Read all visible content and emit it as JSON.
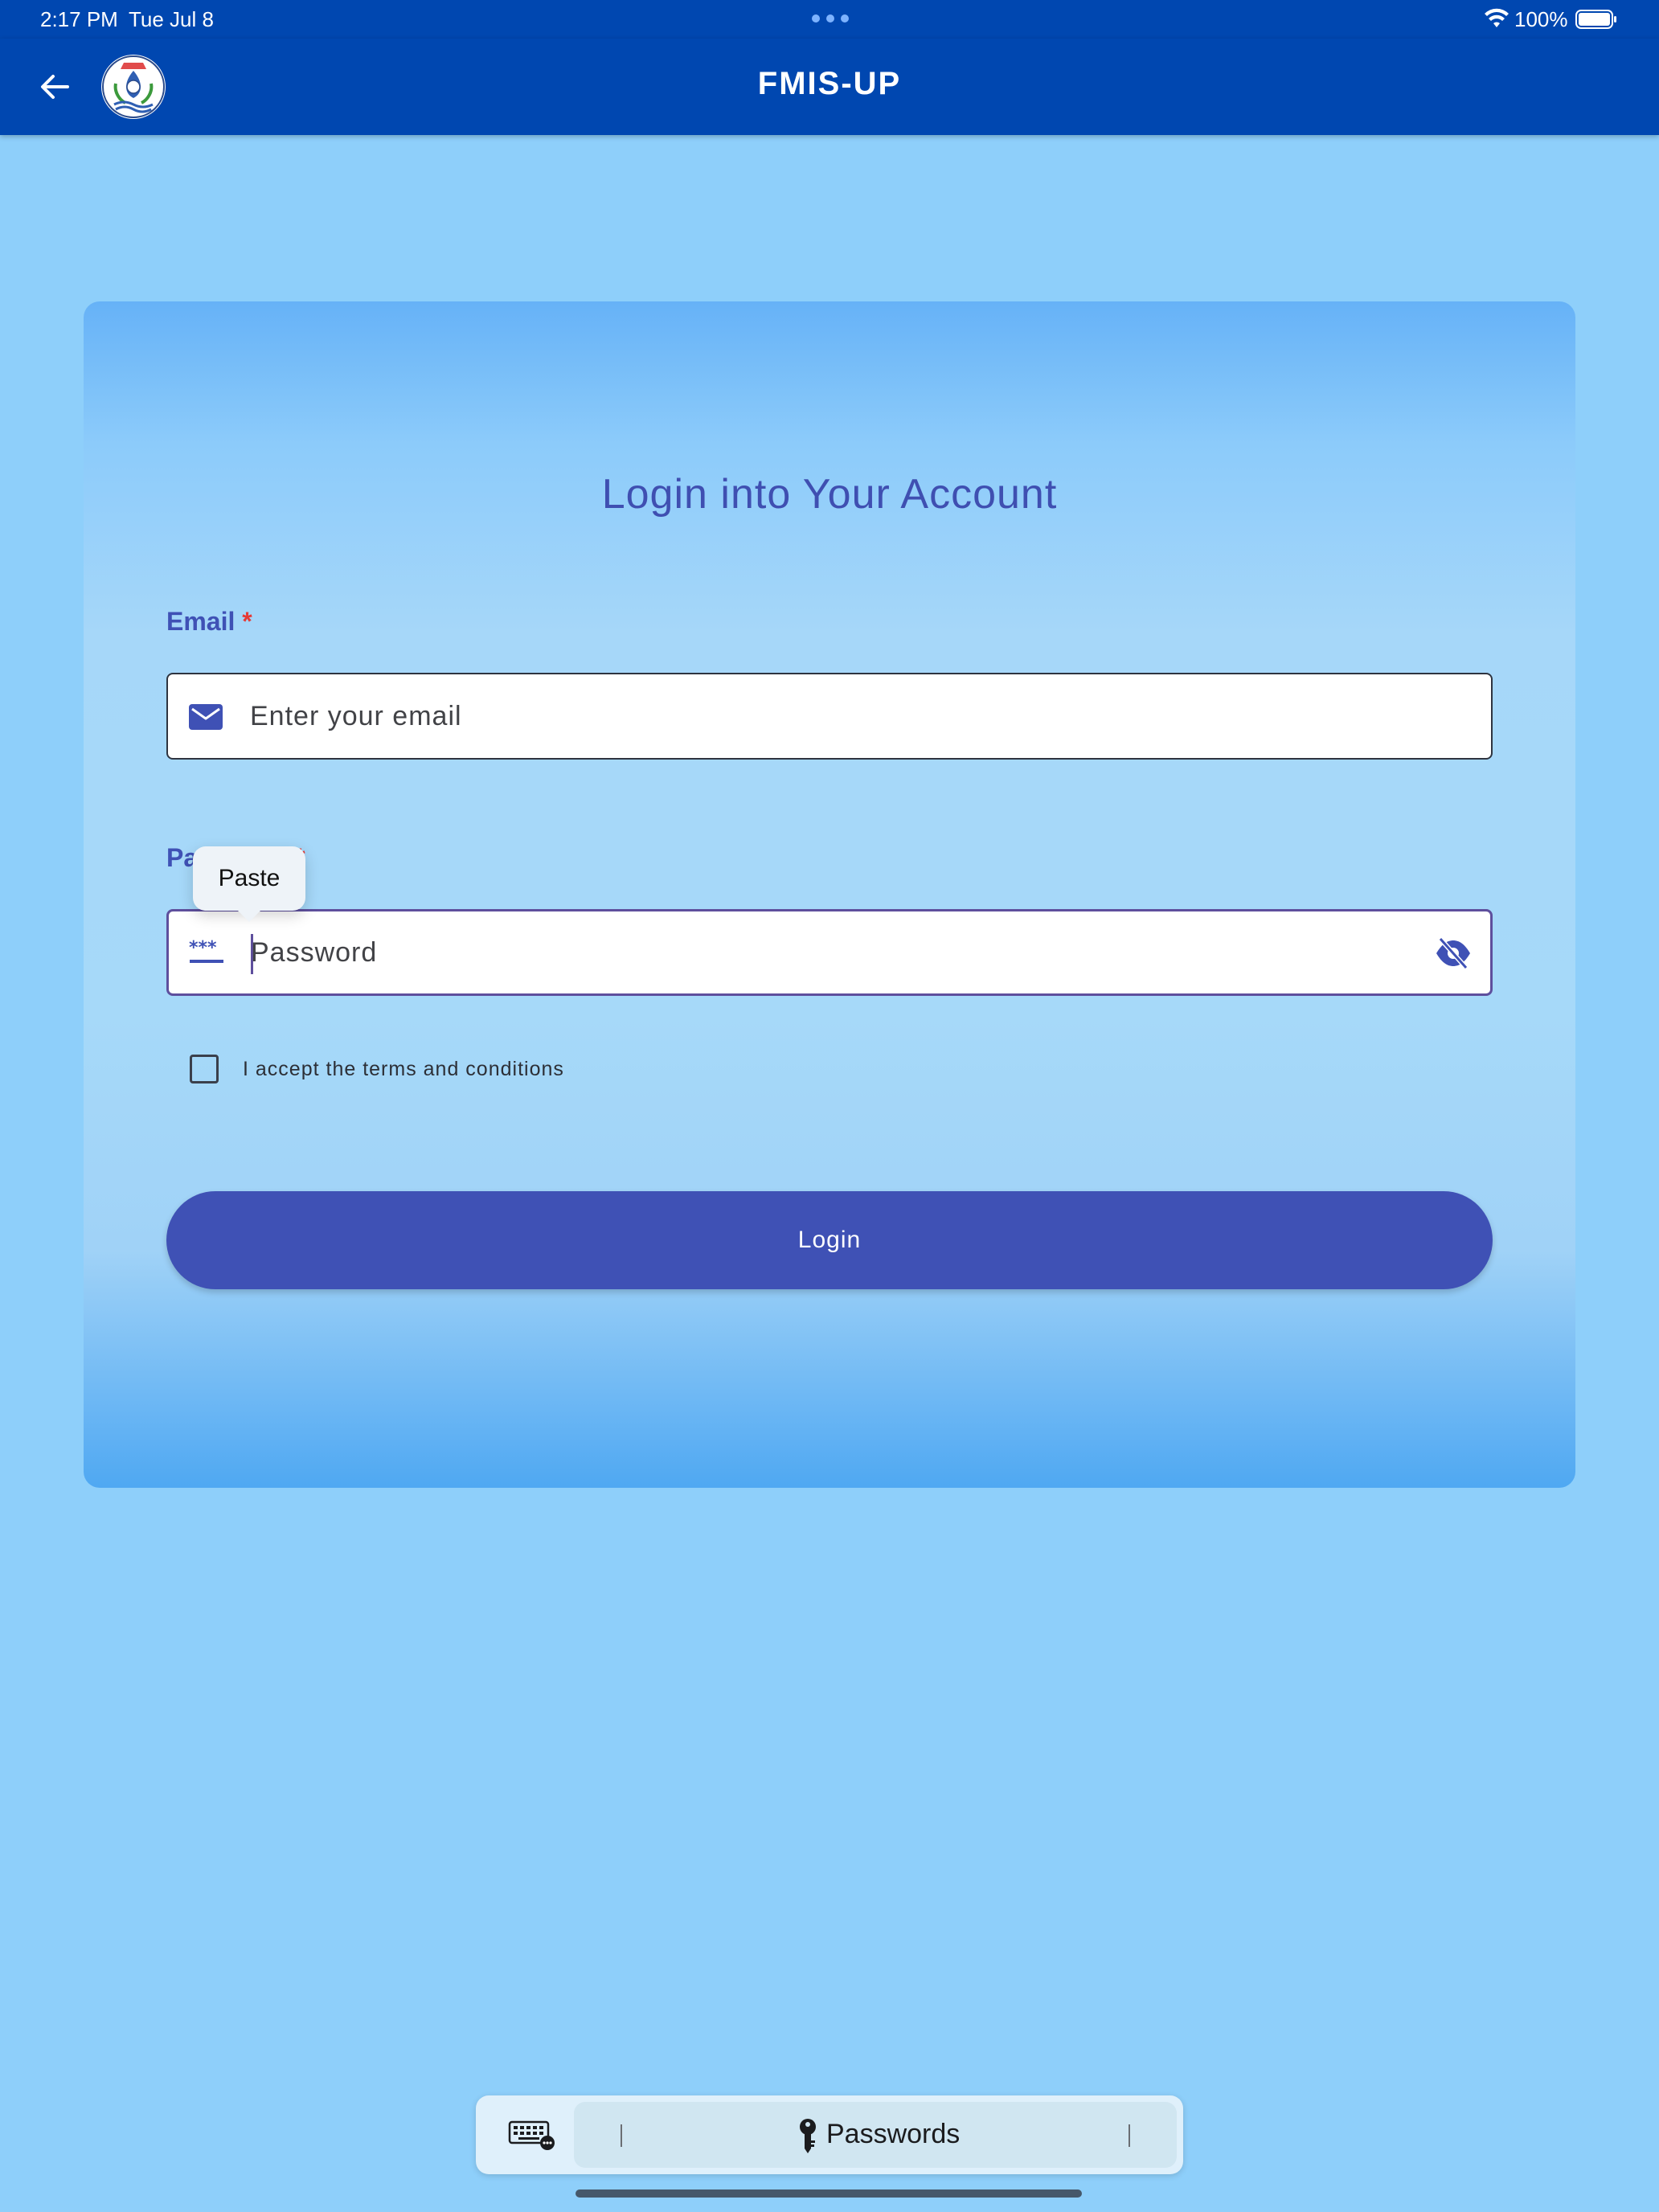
{
  "status_bar": {
    "time": "2:17 PM",
    "date": "Tue Jul 8",
    "battery": "100%"
  },
  "app_bar": {
    "title": "FMIS-UP",
    "back_icon": "arrow-left-icon",
    "logo_icon": "department-emblem-logo"
  },
  "login_card": {
    "title": "Login into Your Account",
    "email": {
      "label": "Email",
      "required_mark": "*",
      "placeholder": "Enter your email",
      "value": "",
      "icon": "envelope-icon"
    },
    "password": {
      "label": "Password",
      "required_mark": "*",
      "placeholder": "Password",
      "value": "",
      "icon": "password-dots-icon",
      "toggle_icon": "eye-off-icon"
    },
    "terms": {
      "label": "I accept the terms and conditions",
      "checked": false
    },
    "login_button": "Login"
  },
  "context_menu": {
    "paste": "Paste"
  },
  "keyboard_bar": {
    "keyboard_icon": "keyboard-icon",
    "key_icon": "key-icon",
    "passwords_label": "Passwords"
  },
  "colors": {
    "app_bar": "#0047b0",
    "background": "#8ecffa",
    "primary": "#3f51b5",
    "required": "#e53935",
    "focus_border": "#5e4f9d"
  }
}
